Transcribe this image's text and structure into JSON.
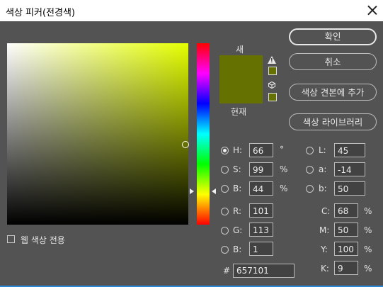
{
  "window": {
    "title": "색상 피커(전경색)",
    "hex_color": "#657101",
    "accent_blue": "#2b88d8"
  },
  "swatch": {
    "new_label": "새",
    "current_label": "현재",
    "gamut_warning_icon": "warning-triangle-icon",
    "web_safe_icon": "cube-icon"
  },
  "buttons": {
    "ok": "확인",
    "cancel": "취소",
    "add_to_swatches": "색상 견본에 추가",
    "color_libraries": "색상 라이브러리"
  },
  "hsb": {
    "h_label": "H:",
    "h_value": "66",
    "h_unit": "°",
    "s_label": "S:",
    "s_value": "99",
    "s_unit": "%",
    "b_label": "B:",
    "b_value": "44",
    "b_unit": "%",
    "selected": "H"
  },
  "lab": {
    "l_label": "L:",
    "l_value": "45",
    "a_label": "a:",
    "a_value": "-14",
    "b_label": "b:",
    "b_value": "50"
  },
  "rgb": {
    "r_label": "R:",
    "r_value": "101",
    "g_label": "G:",
    "g_value": "113",
    "b_label": "B:",
    "b_value": "1"
  },
  "cmyk": {
    "c_label": "C:",
    "c_value": "68",
    "c_unit": "%",
    "m_label": "M:",
    "m_value": "50",
    "m_unit": "%",
    "y_label": "Y:",
    "y_value": "100",
    "y_unit": "%",
    "k_label": "K:",
    "k_value": "9",
    "k_unit": "%"
  },
  "hex": {
    "label": "#",
    "value": "657101"
  },
  "web_colors": {
    "label": "웹 색상 전용",
    "checked": false
  }
}
